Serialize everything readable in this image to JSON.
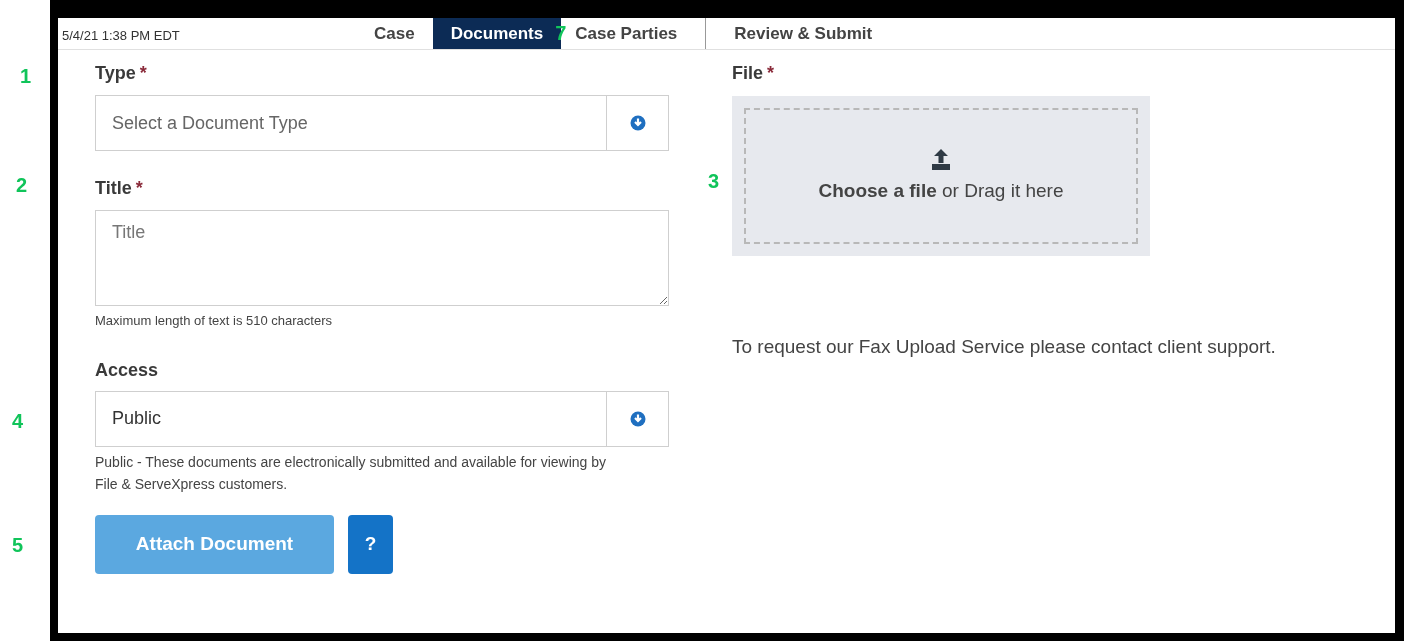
{
  "timestamp": "5/4/21 1:38 PM EDT",
  "tabs": [
    {
      "label": "Case",
      "selected": false
    },
    {
      "label": "Documents",
      "selected": true
    },
    {
      "label": "Case Parties",
      "selected": false,
      "callout": "7"
    },
    {
      "label": "Review & Submit",
      "selected": false
    }
  ],
  "type_field": {
    "label": "Type",
    "required_mark": "*",
    "placeholder": "Select a Document Type",
    "callout": "1"
  },
  "title_field": {
    "label": "Title",
    "required_mark": "*",
    "placeholder": "Title",
    "help": "Maximum length of text is 510 characters",
    "callout": "2"
  },
  "access_field": {
    "label": "Access",
    "value": "Public",
    "help": "Public - These documents are electronically submitted and available for viewing by File & ServeXpress customers.",
    "callout": "4"
  },
  "buttons": {
    "attach": "Attach Document",
    "help": "?",
    "attach_disabled": true,
    "callout": "5"
  },
  "file_field": {
    "label": "File",
    "required_mark": "*",
    "dropzone_text": "**Choose a file** or Drag it here",
    "callout": "3"
  },
  "fax_note": "To request our Fax Upload Service please contact client support."
}
